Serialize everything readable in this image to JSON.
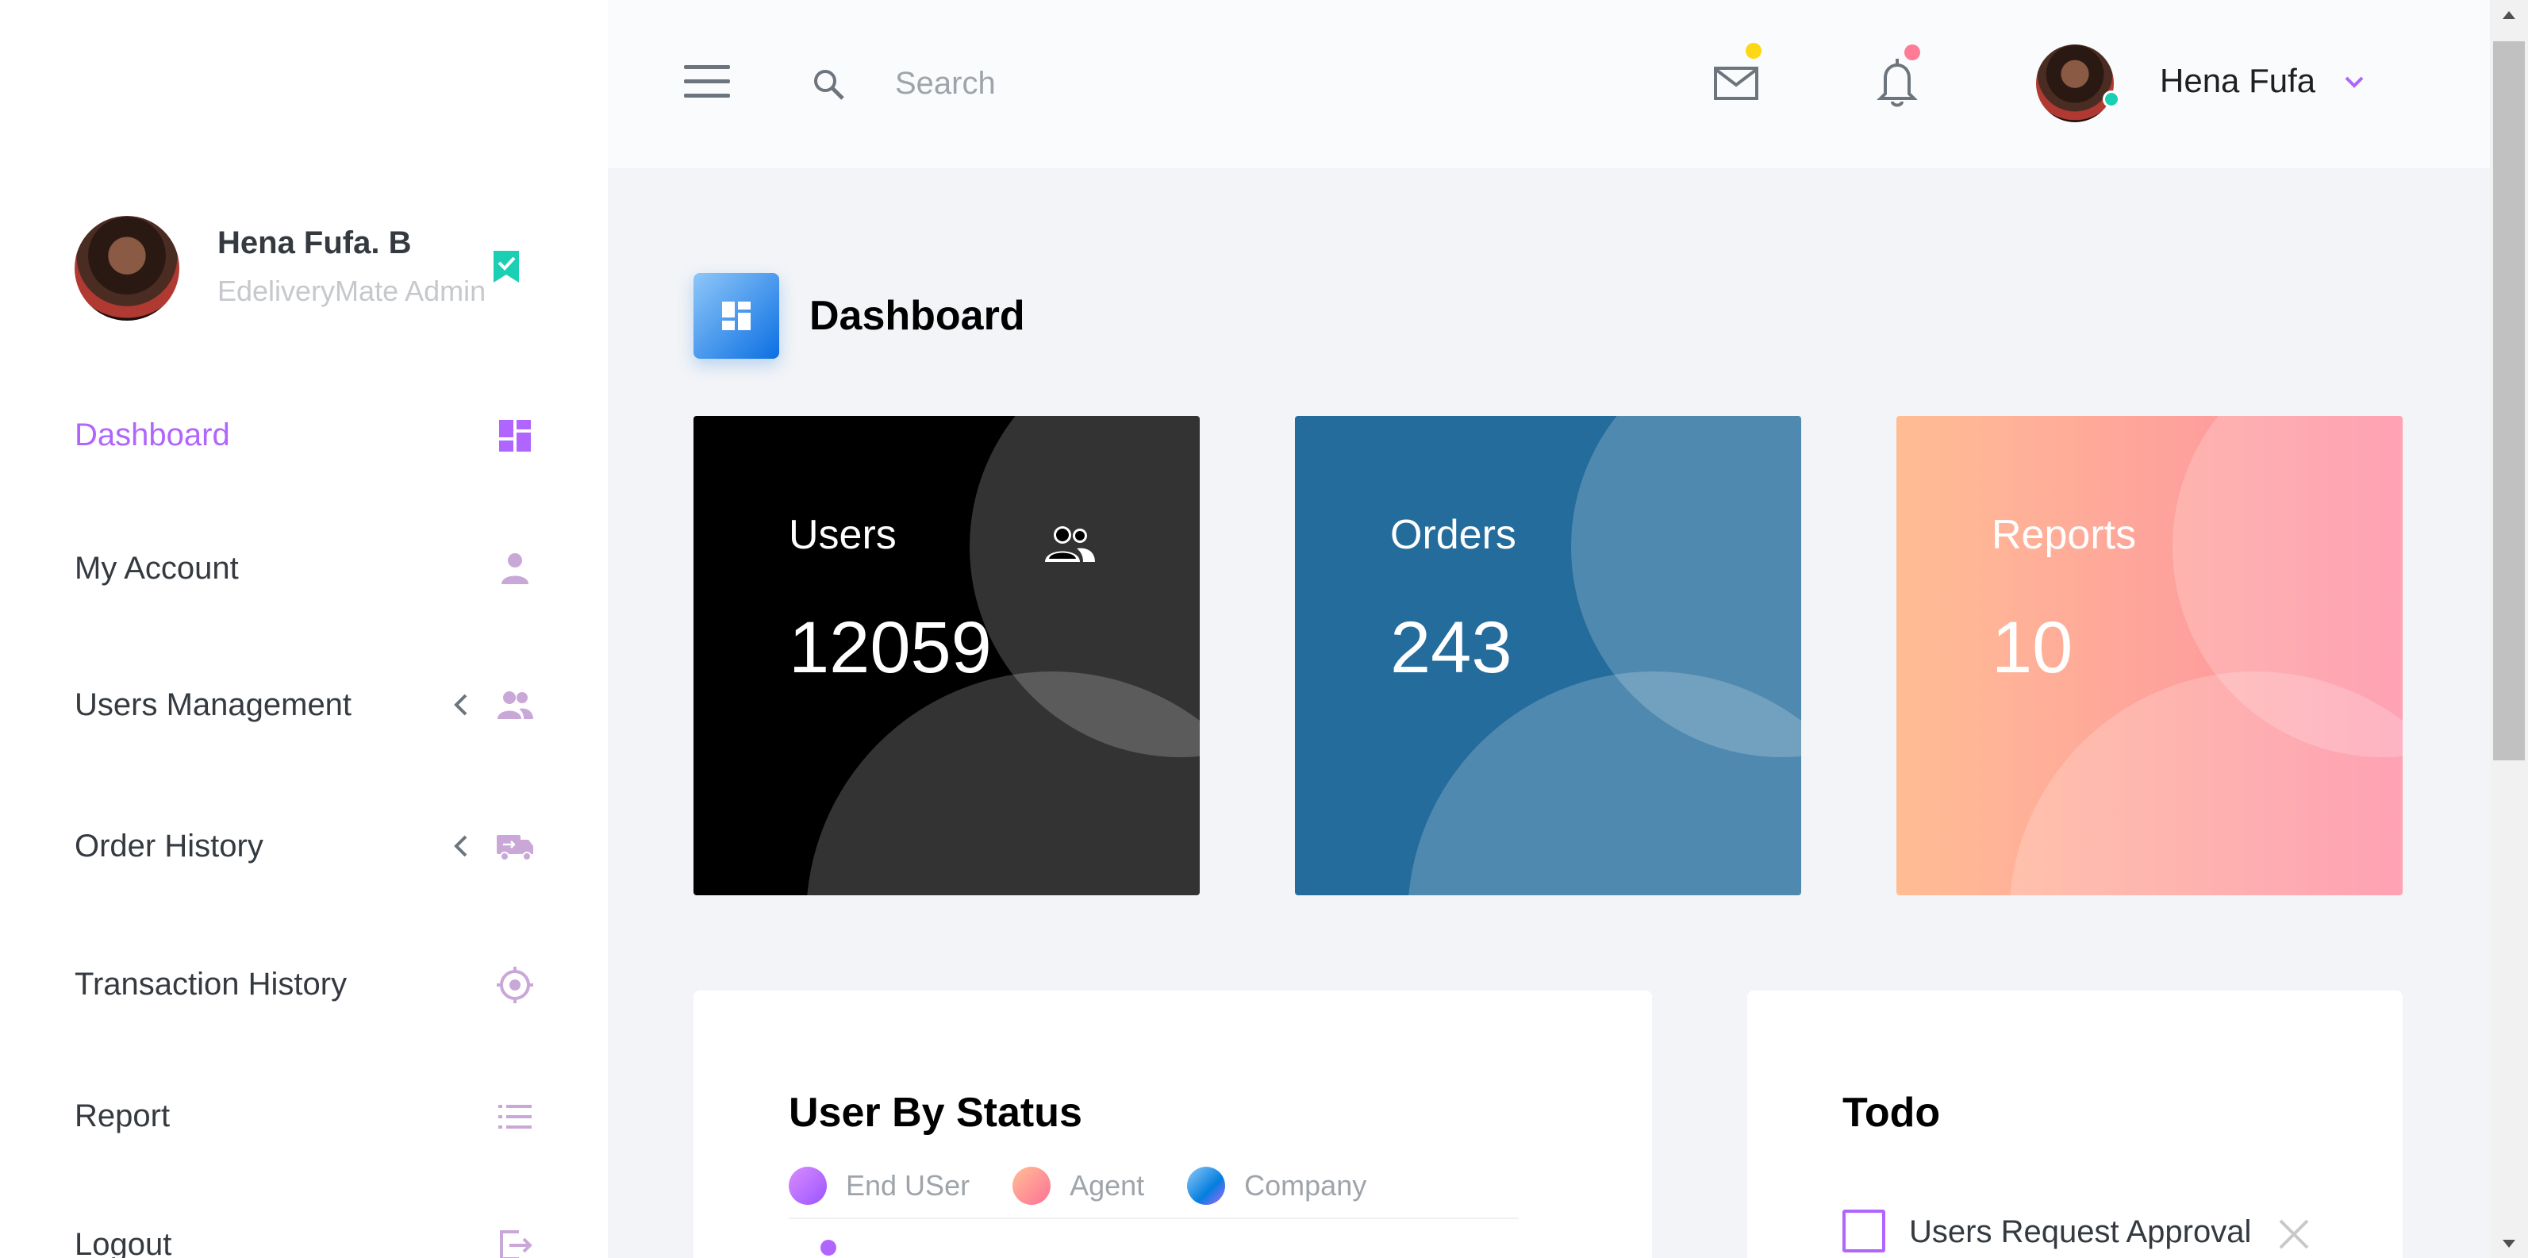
{
  "profile": {
    "name": "Hena Fufa. B",
    "role": "EdeliveryMate Admin"
  },
  "sidebar": {
    "items": [
      {
        "label": "Dashboard",
        "icon": "dashboard-icon",
        "active": true
      },
      {
        "label": "My Account",
        "icon": "person-icon"
      },
      {
        "label": "Users Management",
        "icon": "users-icon",
        "expandable": true
      },
      {
        "label": "Order History",
        "icon": "truck-icon",
        "expandable": true
      },
      {
        "label": "Transaction History",
        "icon": "target-icon"
      },
      {
        "label": "Report",
        "icon": "list-icon"
      },
      {
        "label": "Logout",
        "icon": "logout-icon"
      }
    ]
  },
  "topbar": {
    "search_placeholder": "Search",
    "user_name": "Hena Fufa",
    "mail_badge_color": "#fed713",
    "bell_badge_color": "#fe7c96"
  },
  "page": {
    "title": "Dashboard"
  },
  "stats": [
    {
      "label": "Users",
      "value": "12059",
      "color": "#000000"
    },
    {
      "label": "Orders",
      "value": "243",
      "color": "#246c9c"
    },
    {
      "label": "Reports",
      "value": "10",
      "color": "#fe8ba2"
    }
  ],
  "user_by_status": {
    "title": "User By Status",
    "legend": [
      {
        "label": "End USer",
        "color": "#b066fe"
      },
      {
        "label": "Agent",
        "color": "#fe8ba2"
      },
      {
        "label": "Company",
        "color": "#63b5f5"
      }
    ]
  },
  "todo": {
    "title": "Todo",
    "items": [
      {
        "text": "Users Request Approval",
        "done": false
      }
    ]
  },
  "colors": {
    "accent": "#b066fe",
    "sidebar_icon": "#c9a8d8"
  }
}
